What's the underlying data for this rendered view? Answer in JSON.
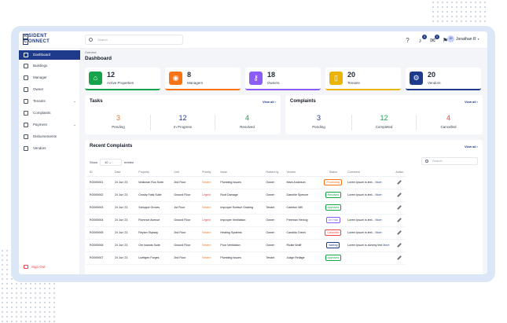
{
  "app": {
    "logo_top": "SIDENT",
    "logo_bottom": "ONNECT",
    "logo_r": "R",
    "logo_c": "C"
  },
  "topbar": {
    "search_placeholder": "Search",
    "notif_count": "3",
    "mail_count": "2",
    "user_name": "Jonathan R",
    "user_initials": "JR"
  },
  "sidebar": {
    "items": [
      {
        "label": "Dashboard"
      },
      {
        "label": "Buildings"
      },
      {
        "label": "Manager"
      },
      {
        "label": "Owner"
      },
      {
        "label": "Tenants"
      },
      {
        "label": "Complaints"
      },
      {
        "label": "Payment"
      },
      {
        "label": "Disbursements"
      },
      {
        "label": "Vendors"
      }
    ],
    "signout": "Sign Out"
  },
  "header": {
    "breadcrumb": "Overview",
    "title": "Dashboard"
  },
  "stats": [
    {
      "value": "12",
      "label": "Active Properties",
      "color": "#16a34a"
    },
    {
      "value": "8",
      "label": "Managers",
      "color": "#f97316"
    },
    {
      "value": "18",
      "label": "Owners",
      "color": "#8b5cf6"
    },
    {
      "value": "20",
      "label": "Tenants",
      "color": "#eab308"
    },
    {
      "value": "20",
      "label": "Vendors",
      "color": "#1e3a8a"
    }
  ],
  "tasks": {
    "title": "Tasks",
    "view_all": "View all ›",
    "cols": [
      {
        "value": "3",
        "label": "Pending",
        "color": "#f97316"
      },
      {
        "value": "12",
        "label": "In Progress",
        "color": "#1e3a8a"
      },
      {
        "value": "4",
        "label": "Resolved",
        "color": "#16a34a"
      }
    ]
  },
  "complaints": {
    "title": "Complaints",
    "view_all": "View all ›",
    "cols": [
      {
        "value": "3",
        "label": "Pending",
        "color": "#1e3a8a"
      },
      {
        "value": "12",
        "label": "Completed",
        "color": "#16a34a"
      },
      {
        "value": "4",
        "label": "Cancelled",
        "color": "#ef4444"
      }
    ]
  },
  "recent": {
    "title": "Recent Complaints",
    "view_all": "View all ›",
    "show_label": "Show",
    "show_value": "10",
    "entries_label": "entries",
    "search_placeholder": "Search",
    "columns": [
      "ID",
      "Date",
      "Property",
      "Unit",
      "Priority",
      "Issue",
      "Raised by",
      "Vendor",
      "Status",
      "Comment",
      "Action"
    ],
    "rows": [
      [
        "RO000001",
        "24 Jun '23",
        "Wolkman Run Suite",
        "2nd Floor",
        "Severe",
        "Plumbing Issues",
        "Owner",
        "Mark Anderson",
        "Processing",
        "Lorem Ipsum is text...",
        "More"
      ],
      [
        "RO000002",
        "24 Jun '23",
        "Crosby Falls Suite",
        "Ground Floor",
        "Urgent",
        "Roof Damage",
        "Owner",
        "Darnelle Spencer",
        "Resolved",
        "Lorem Ipsum is text...",
        "More"
      ],
      [
        "RO000003",
        "24 Jun '23",
        "Schuppe Groves",
        "1st Floor",
        "Severe",
        "Improper Surface Grading",
        "Tenant",
        "Carleton Will",
        "Approved",
        "",
        ""
      ],
      [
        "RO000004",
        "24 Jun '23",
        "Florence Avenue",
        "Ground Floor",
        "Urgent",
        "Improper Ventilation",
        "Owner",
        "Freeman Herzog",
        "On Hold",
        "Lorem Ipsum is text...",
        "More"
      ],
      [
        "RO000005",
        "24 Jun '23",
        "Reyton Skyway",
        "2nd Floor",
        "Severe",
        "Heating Systems",
        "Owner",
        "Candido Green",
        "Cancelled",
        "Lorem Ipsum is text...",
        "More"
      ],
      [
        "RO000006",
        "24 Jun '23",
        "Orn Islands Suite",
        "Ground Floor",
        "Severe",
        "Poor Ventilation",
        "Owner",
        "Rickie Wolff",
        "Waiting",
        "Lorem Ipsum is dummy text",
        "More"
      ],
      [
        "RO000007",
        "24 Jun '23",
        "Luettgen Forges",
        "2nd Floor",
        "Severe",
        "Plumbing Issues",
        "Tenant",
        "Judge Reilage",
        "Approved",
        "",
        ""
      ]
    ],
    "status_colors": {
      "Processing": "#f97316",
      "Resolved": "#16a34a",
      "Approved": "#16a34a",
      "On Hold": "#8b5cf6",
      "Cancelled": "#ef4444",
      "Waiting": "#1e3a8a"
    }
  }
}
